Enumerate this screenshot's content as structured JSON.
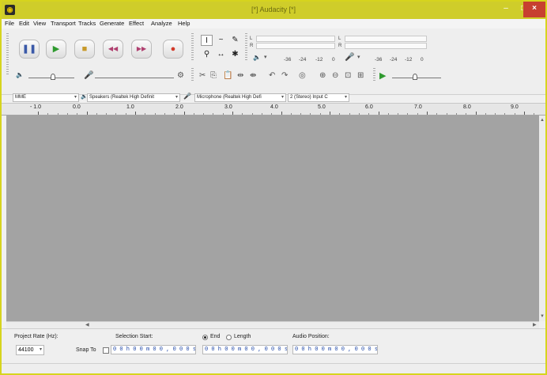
{
  "window": {
    "title": "[*] Audacity [*]",
    "controls": {
      "minimize": "–",
      "maximize": "□",
      "close": "×"
    }
  },
  "menu": [
    "File",
    "Edit",
    "View",
    "Transport",
    "Tracks",
    "Generate",
    "Effect",
    "Analyze",
    "Help"
  ],
  "transport": {
    "buttons": [
      {
        "name": "pause",
        "glyph": "❚❚",
        "color": "#3a59a8"
      },
      {
        "name": "play",
        "glyph": "▶",
        "color": "#2f9a2f"
      },
      {
        "name": "stop",
        "glyph": "■",
        "color": "#c89a2a"
      },
      {
        "name": "skip-start",
        "glyph": "◀◀",
        "color": "#b04070"
      },
      {
        "name": "skip-end",
        "glyph": "▶▶",
        "color": "#b04070"
      },
      {
        "name": "record",
        "glyph": "●",
        "color": "#d23a2a"
      }
    ]
  },
  "tools": [
    "I",
    "~",
    "✎",
    "⚲",
    "↔",
    "✱"
  ],
  "meters": {
    "record_channels": [
      "L",
      "R"
    ],
    "play_channels": [
      "L",
      "R"
    ],
    "record_scale": [
      "-36",
      "-24",
      "-12",
      "0"
    ],
    "play_scale": [
      "-36",
      "-24",
      "-12",
      "0"
    ]
  },
  "devices": {
    "host": "MME",
    "speakers": "Speakers (Realtek High Definit",
    "microphone": "Microphone (Realtek High Defi",
    "channels": "2 (Stereo) Input C"
  },
  "ruler": {
    "labels": [
      "- 1.0",
      "0.0",
      "1.0",
      "2.0",
      "3.0",
      "4.0",
      "5.0",
      "6.0",
      "7.0",
      "8.0",
      "9.0"
    ]
  },
  "selection_toolbar": {
    "project_rate_label": "Project Rate (Hz):",
    "project_rate_value": "44100",
    "snap_to_label": "Snap To",
    "selection_start_label": "Selection Start:",
    "end_label": "End",
    "length_label": "Length",
    "audio_position_label": "Audio Position:",
    "selection_start_value": "0 0 h 0 0 m 0 0 , 0 0 0 s",
    "end_value": "0 0 h 0 0 m 0 0 , 0 0 0 s",
    "audio_position_value": "0 0 h 0 0 m 0 0 , 0 0 0 s"
  },
  "colors": {
    "title_bar": "#cfcd2a",
    "track_background": "#a3a3a3",
    "close_button": "#c74030",
    "time_digits": "#2048a8"
  }
}
